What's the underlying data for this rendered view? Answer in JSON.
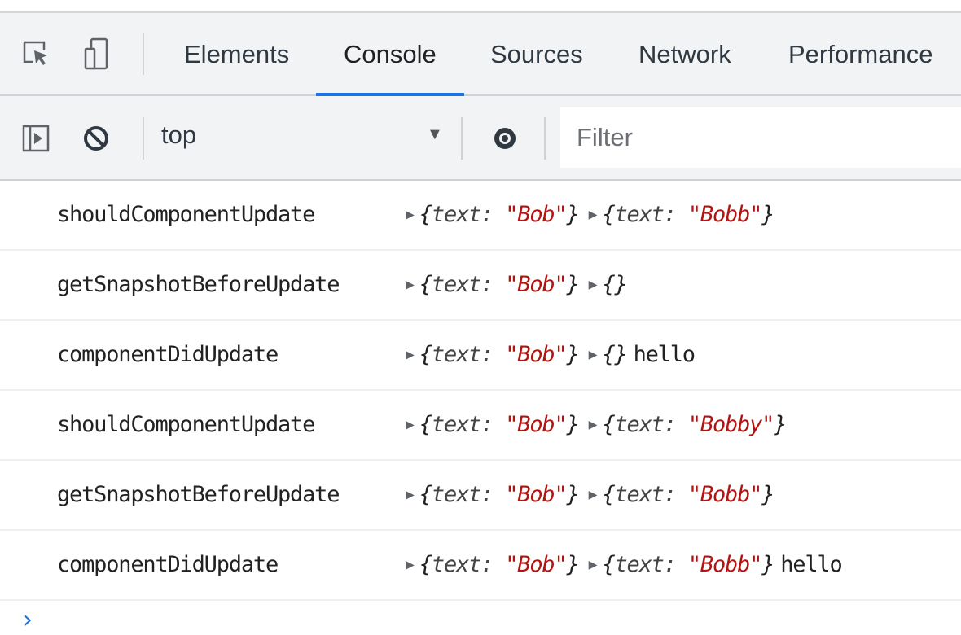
{
  "tabs": [
    {
      "label": "Elements"
    },
    {
      "label": "Console",
      "active": true
    },
    {
      "label": "Sources"
    },
    {
      "label": "Network"
    },
    {
      "label": "Performance"
    }
  ],
  "toolbar": {
    "context": "top",
    "filter_placeholder": "Filter"
  },
  "messages": [
    {
      "method": "shouldComponentUpdate",
      "arg1_key": "text: ",
      "arg1_val": "\"Bob\"",
      "arg2_key": "text: ",
      "arg2_val": "\"Bobb\"",
      "tail": ""
    },
    {
      "method": "getSnapshotBeforeUpdate",
      "arg1_key": "text: ",
      "arg1_val": "\"Bob\"",
      "arg2_key": "",
      "arg2_val": "",
      "tail": ""
    },
    {
      "method": "componentDidUpdate",
      "arg1_key": "text: ",
      "arg1_val": "\"Bob\"",
      "arg2_key": "",
      "arg2_val": "",
      "tail": "hello"
    },
    {
      "method": "shouldComponentUpdate",
      "arg1_key": "text: ",
      "arg1_val": "\"Bob\"",
      "arg2_key": "text: ",
      "arg2_val": "\"Bobby\"",
      "tail": ""
    },
    {
      "method": "getSnapshotBeforeUpdate",
      "arg1_key": "text: ",
      "arg1_val": "\"Bob\"",
      "arg2_key": "text: ",
      "arg2_val": "\"Bobb\"",
      "tail": ""
    },
    {
      "method": "componentDidUpdate",
      "arg1_key": "text: ",
      "arg1_val": "\"Bob\"",
      "arg2_key": "text: ",
      "arg2_val": "\"Bobb\"",
      "tail": "hello"
    }
  ],
  "prompt": "›",
  "colors": {
    "accent": "#1a73e8",
    "string": "#b31412"
  }
}
